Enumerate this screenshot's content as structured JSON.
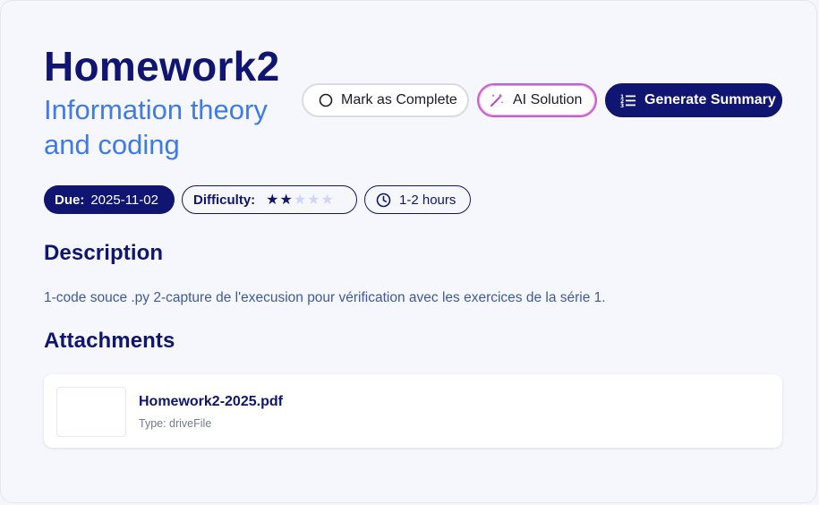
{
  "assignment": {
    "title": "Homework2",
    "course": "Information theory and coding"
  },
  "actions": {
    "mark_complete": "Mark as Complete",
    "ai_solution": "AI Solution",
    "generate_summary": "Generate Summary",
    "mark_complete_icon": "circle-outline-icon",
    "ai_solution_icon": "magic-wand-icon",
    "generate_summary_icon": "list-icon"
  },
  "meta": {
    "due_label": "Due:",
    "due_value": "2025-11-02",
    "difficulty_label": "Difficulty:",
    "difficulty_rating": 2,
    "difficulty_max": 5,
    "time_estimate": "1-2 hours",
    "time_icon": "clock-icon"
  },
  "description": {
    "heading": "Description",
    "text": "1-code souce .py 2-capture de l'execusion pour vérification avec les exercices de la série 1."
  },
  "attachments": {
    "heading": "Attachments",
    "items": [
      {
        "name": "Homework2-2025.pdf",
        "type": "Type: driveFile"
      }
    ]
  },
  "colors": {
    "primary": "#0f1570",
    "accent_blue": "#3f7be8",
    "ai_border": "#c85bd6",
    "background": "#f5f7fd"
  }
}
